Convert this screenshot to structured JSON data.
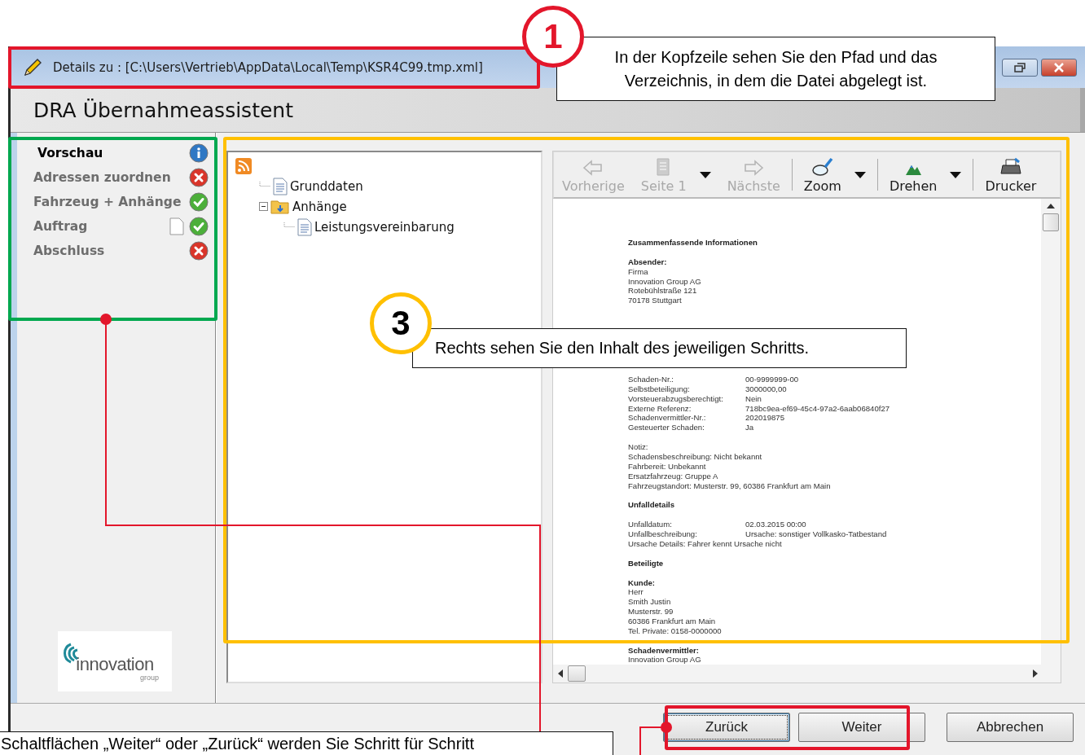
{
  "window": {
    "title": "Details zu : [C:\\Users\\Vertrieb\\AppData\\Local\\Temp\\KSR4C99.tmp.xml]",
    "heading": "DRA Übernahmeassistent"
  },
  "steps": [
    {
      "label": "Vorschau",
      "selected": true,
      "kind": "info",
      "document": false
    },
    {
      "label": "Adressen zuordnen",
      "selected": false,
      "kind": "error",
      "document": false
    },
    {
      "label": "Fahrzeug + Anhänge",
      "selected": false,
      "kind": "ok",
      "document": false
    },
    {
      "label": "Auftrag",
      "selected": false,
      "kind": "ok",
      "document": true
    },
    {
      "label": "Abschluss",
      "selected": false,
      "kind": "error",
      "document": false
    }
  ],
  "logo": {
    "name": "innovation",
    "sub": "group"
  },
  "tree": {
    "children": [
      {
        "label": "Grunddaten",
        "kind": "document"
      },
      {
        "label": "Anhänge",
        "kind": "folder",
        "expanded": true,
        "children": [
          {
            "label": "Leistungsvereinbarung",
            "kind": "document"
          }
        ]
      }
    ]
  },
  "toolbar": [
    {
      "label": "Vorherige",
      "kind": "back",
      "disabled": true,
      "dropdown": false
    },
    {
      "label": "Seite 1",
      "kind": "page",
      "disabled": true,
      "dropdown": true
    },
    {
      "label": "Nächste",
      "kind": "forward",
      "disabled": true,
      "dropdown": false
    },
    {
      "label": "Zoom",
      "kind": "zoom",
      "disabled": false,
      "dropdown": true
    },
    {
      "label": "Drehen",
      "kind": "rotate",
      "disabled": false,
      "dropdown": true
    },
    {
      "label": "Drucker",
      "kind": "print",
      "disabled": false,
      "dropdown": false
    }
  ],
  "document": [
    {
      "title": "Zusammenfassende Informationen"
    },
    {
      "title": "Absender:",
      "rows": [
        {
          "kind": "text",
          "text": "Firma"
        },
        {
          "kind": "text",
          "text": "Innovation Group AG"
        },
        {
          "kind": "text",
          "text": "Rotebühlstraße 121"
        },
        {
          "kind": "text",
          "text": "70178 Stuttgart"
        }
      ]
    },
    {
      "rows": [
        {
          "kind": "pair",
          "label": "Schaden-Nr.:",
          "value": "00-9999999-00"
        },
        {
          "kind": "pair",
          "label": "Selbstbeteiligung:",
          "value": "3000000,00"
        },
        {
          "kind": "pair",
          "label": "Vorsteuerabzugsberechtigt:",
          "value": "Nein"
        },
        {
          "kind": "pair",
          "label": "Externe Referenz:",
          "value": "718bc9ea-ef69-45c4-97a2-6aab06840f27"
        },
        {
          "kind": "pair",
          "label": "Schadenvermittler-Nr.:",
          "value": "202019875"
        },
        {
          "kind": "pair",
          "label": "Gesteuerter Schaden:",
          "value": "Ja"
        }
      ]
    },
    {
      "rows": [
        {
          "kind": "text",
          "text": "Notiz:"
        },
        {
          "kind": "text",
          "text": "Schadensbeschreibung: Nicht bekannt"
        },
        {
          "kind": "text",
          "text": "Fahrbereit: Unbekannt"
        },
        {
          "kind": "text",
          "text": "Ersatzfahrzeug: Gruppe A"
        },
        {
          "kind": "text",
          "text": "Fahrzeugstandort: Musterstr. 99, 60386 Frankfurt am Main"
        }
      ]
    },
    {
      "title": "Unfalldetails"
    },
    {
      "rows": [
        {
          "kind": "pair",
          "label": "Unfalldatum:",
          "value": "02.03.2015 00:00"
        },
        {
          "kind": "pair",
          "label": "Unfallbeschreibung:",
          "value": "Ursache: sonstiger Vollkasko-Tatbestand"
        },
        {
          "kind": "text",
          "text": "Ursache Details: Fahrer kennt Ursache nicht"
        }
      ]
    },
    {
      "title": "Beteiligte"
    },
    {
      "title": "Kunde:",
      "rows": [
        {
          "kind": "text",
          "text": "Herr"
        },
        {
          "kind": "text",
          "text": "Smith Justin"
        },
        {
          "kind": "text",
          "text": "Musterstr. 99"
        },
        {
          "kind": "text",
          "text": "60386 Frankfurt am Main"
        },
        {
          "kind": "text",
          "text": "Tel. Private: 0158-0000000"
        }
      ]
    },
    {
      "title": "Schadenvermittler:",
      "rows": [
        {
          "kind": "text",
          "text": "Innovation Group AG"
        }
      ]
    }
  ],
  "buttons": [
    {
      "label": "Zurück",
      "focused": true
    },
    {
      "label": "Weiter",
      "focused": false
    },
    {
      "label": "Abbrechen",
      "focused": false
    }
  ],
  "highlights": [
    {
      "color": "#e3162b"
    },
    {
      "color": "#00a84f"
    },
    {
      "color": "#ffc000"
    },
    {
      "color": "#e3162b"
    }
  ],
  "callouts": [
    {
      "kind": "numbered",
      "number": "1",
      "color": "#e3162b",
      "text": "In der Kopfzeile sehen Sie den Pfad und das Verzeichnis, in dem die Datei abgelegt ist."
    },
    {
      "kind": "numbered",
      "number": "3",
      "color": "#ffc000",
      "text": "Rechts sehen Sie den Inhalt des jeweiligen Schritts."
    },
    {
      "kind": "plain",
      "text": "Schaltflächen „Weiter“ oder „Zurück“ werden Sie Schritt für Schritt"
    }
  ]
}
